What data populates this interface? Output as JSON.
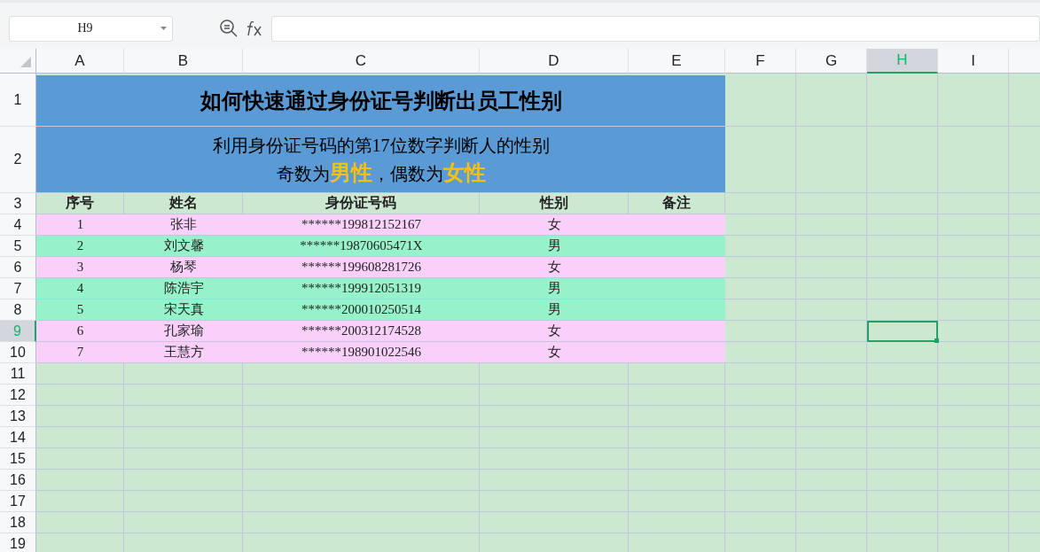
{
  "name_box": {
    "value": "H9"
  },
  "columns": [
    {
      "label": "A",
      "selected": false
    },
    {
      "label": "B",
      "selected": false
    },
    {
      "label": "C",
      "selected": false
    },
    {
      "label": "D",
      "selected": false
    },
    {
      "label": "E",
      "selected": false
    },
    {
      "label": "F",
      "selected": false
    },
    {
      "label": "G",
      "selected": false
    },
    {
      "label": "H",
      "selected": true
    },
    {
      "label": "I",
      "selected": false
    }
  ],
  "rows": [
    {
      "label": "1",
      "selected": false
    },
    {
      "label": "2",
      "selected": false
    },
    {
      "label": "3",
      "selected": false
    },
    {
      "label": "4",
      "selected": false
    },
    {
      "label": "5",
      "selected": false
    },
    {
      "label": "6",
      "selected": false
    },
    {
      "label": "7",
      "selected": false
    },
    {
      "label": "8",
      "selected": false
    },
    {
      "label": "9",
      "selected": true
    },
    {
      "label": "10",
      "selected": false
    },
    {
      "label": "11",
      "selected": false
    },
    {
      "label": "12",
      "selected": false
    },
    {
      "label": "13",
      "selected": false
    },
    {
      "label": "14",
      "selected": false
    },
    {
      "label": "15",
      "selected": false
    },
    {
      "label": "16",
      "selected": false
    },
    {
      "label": "17",
      "selected": false
    },
    {
      "label": "18",
      "selected": false
    },
    {
      "label": "19",
      "selected": false
    }
  ],
  "title": "如何快速通过身份证号判断出员工性别",
  "subtitle": [
    "利用身份证号码的第17位数字判断人的性别",
    "奇数为**男性**，偶数为**女性**"
  ],
  "table_header": [
    "序号",
    "姓名",
    "身份证号码",
    "性别",
    "备注"
  ],
  "records": [
    {
      "cells": [
        "1",
        "张非",
        "******199812152167",
        "女"
      ],
      "color": "#f9d0f9"
    },
    {
      "cells": [
        "2",
        "刘文馨",
        "******19870605471X",
        "男"
      ],
      "color": "#96f2c8"
    },
    {
      "cells": [
        "3",
        "杨琴",
        "******199608281726",
        "女"
      ],
      "color": "#f9d0f9"
    },
    {
      "cells": [
        "4",
        "陈浩宇",
        "******199912051319",
        "男"
      ],
      "color": "#96f2c8"
    },
    {
      "cells": [
        "5",
        "宋天真",
        "******200010250514",
        "男"
      ],
      "color": "#96f2c8"
    },
    {
      "cells": [
        "6",
        "孔家瑜",
        "******200312174528",
        "女"
      ],
      "color": "#f9d0f9"
    },
    {
      "cells": [
        "7",
        "王慧方",
        "******198901022546",
        "女"
      ],
      "color": "#f9d0f9"
    }
  ]
}
